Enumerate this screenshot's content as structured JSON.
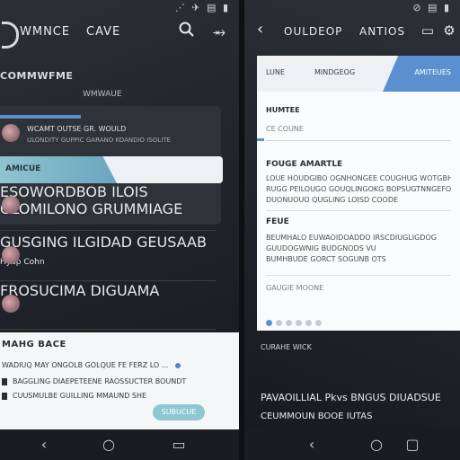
{
  "left": {
    "status": {
      "time": "",
      "icons": "⋰ ✈ ▤ ▮"
    },
    "appbar": {
      "title": "WMNCE",
      "title2": "CAVE",
      "search_icon": "search-icon",
      "menu_icon": "link-icon"
    },
    "section_title": "COMMWFME",
    "section_sub": "WMWAUE",
    "list": [
      {
        "line1": "WCAMT OUTSE GR. WOULD",
        "line2": "ULONDITY GUPPIC GARANO KOANDIO ISOLITE"
      }
    ],
    "highlight_label": "AMICUE",
    "rows": [
      {
        "line1": "ESOWORDBOB",
        "line2": "ILOIS GLOMILONO GRUMMIAGE",
        "meta": ""
      },
      {
        "line1": "GUSGING",
        "line2": "ILGIDAD GEUSAAB",
        "meta": "Hyup Cohn"
      },
      {
        "line1": "FROSUCIMA",
        "line2": "DIGUAMA",
        "meta": ""
      }
    ],
    "panel": {
      "title": "MAHG BACE",
      "line1": "WADIUQ MAY ONGOLB GOLQUE FE FERZ LO ...",
      "line2": "BAGGLING DIAEPETEENE RAOSSUCTER BOUNDT",
      "line3": "CUUSMULBE GUILLING MMAUND SHE",
      "pill": "SUBUCUE"
    },
    "nav": {
      "back": "‹",
      "home": "○",
      "recent": "▭"
    }
  },
  "right": {
    "status": {
      "time": "",
      "icons": "⊘ ▤ ▮"
    },
    "appbar": {
      "title": "OULDEOP",
      "title2": "ANTIOS"
    },
    "tabs": [
      "LUNE",
      "MINDGEOG",
      "AMITEUES"
    ],
    "field_label": "HUMTEE",
    "field_placeholder": "CE COUNE",
    "block1_title": "FOUGE AMARTLE",
    "block1_text1": "LOUE HOUDGIBO OGNHONGEE COUGHUG WOTGBHEDD",
    "block1_text2": "RUGG PEILOUGO GOUQLINGOKG BOPSUGTNNGEFO",
    "block1_text3": "DUONUOUO QUGLING LOISD COODE",
    "block2_title": "FEUE",
    "block2_text1": "BEUMHALO EUWAOIDOADDO IRSCDIUGLIGDOG",
    "block2_text2": "GUUDOGWNIG BUDGNODS VU",
    "block2_text3": "BUMHBUDE GORCT SOGUNB OTS",
    "link_text": "GAUGIE MOONE",
    "pager": 6,
    "pager_active": 1,
    "below1": "CURAHE WICK",
    "below2": "PAVAOILLIAL Pkvs BNGUS DIUADSUE",
    "below3": "CEUMMOUN BOOE IUTAS",
    "nav": {
      "back": "‹",
      "home": "○",
      "recent": "▢"
    }
  }
}
